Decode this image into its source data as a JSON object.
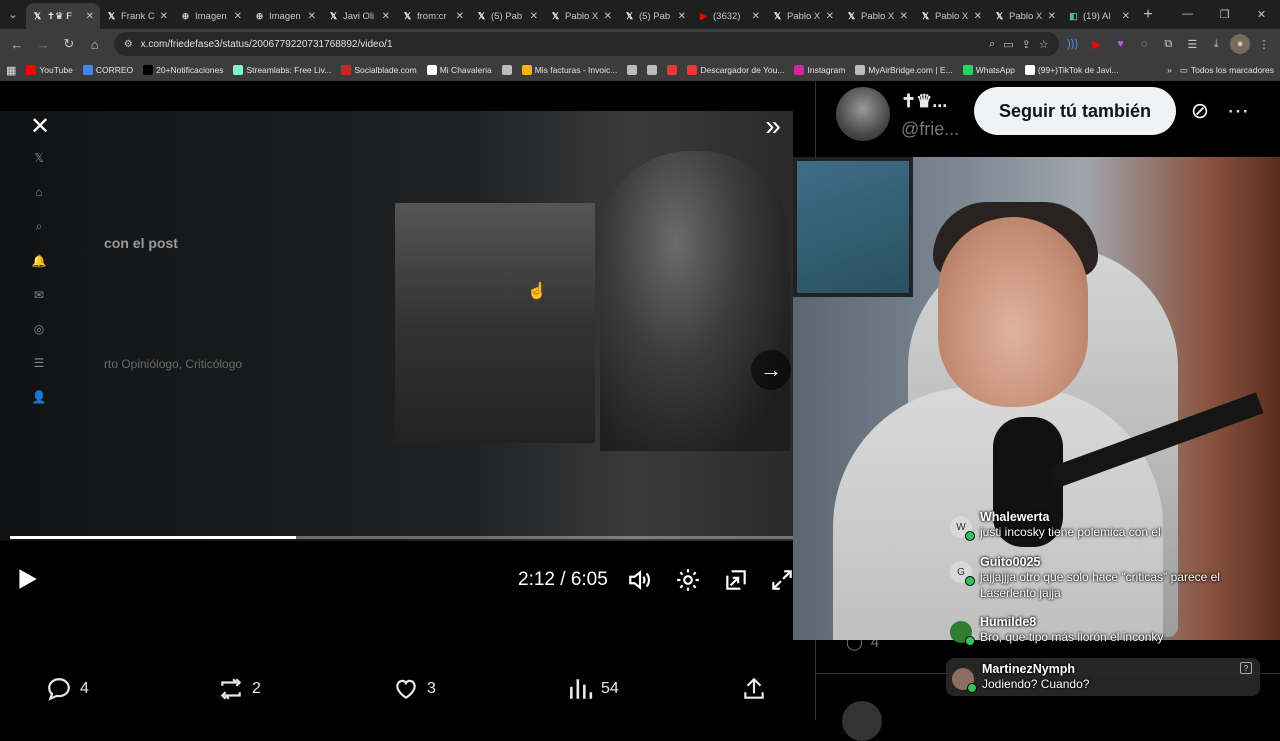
{
  "browser": {
    "tabs": [
      {
        "icon": "x-icon",
        "title": "✝♛ F",
        "active": true
      },
      {
        "icon": "x-icon",
        "title": "Frank C"
      },
      {
        "icon": "globe-icon",
        "title": "Imagen"
      },
      {
        "icon": "globe-icon",
        "title": "Imagen"
      },
      {
        "icon": "x-icon",
        "title": "Javi Oli"
      },
      {
        "icon": "x-icon",
        "title": "from:cr"
      },
      {
        "icon": "x-icon",
        "title": "(5) Pab"
      },
      {
        "icon": "x-icon",
        "title": "Pablo X"
      },
      {
        "icon": "x-icon",
        "title": "(5) Pab"
      },
      {
        "icon": "youtube-icon",
        "title": "(3632)"
      },
      {
        "icon": "x-icon",
        "title": "Pablo X"
      },
      {
        "icon": "x-icon",
        "title": "Pablo X"
      },
      {
        "icon": "x-icon",
        "title": "Pablo X"
      },
      {
        "icon": "x-icon",
        "title": "Pablo X"
      },
      {
        "icon": "site-icon",
        "title": "(19) Al"
      }
    ],
    "url": "x.com/friedefase3/status/2006779220731768892/video/1",
    "bookmarks": [
      {
        "icon": "youtube-icon",
        "label": "YouTube",
        "color": "#ff0000"
      },
      {
        "icon": "correo-icon",
        "label": "CORREO",
        "color": "#4285f4"
      },
      {
        "icon": "x-icon",
        "label": "20+Notificaciones",
        "color": "#000000"
      },
      {
        "icon": "streamlabs-icon",
        "label": "Streamlabs: Free Liv...",
        "color": "#80f5d2"
      },
      {
        "icon": "socialblade-icon",
        "label": "Socialblade.com",
        "color": "#c62828"
      },
      {
        "icon": "chavaleria-icon",
        "label": "Mi Chavaleria",
        "color": "#ffffff"
      },
      {
        "icon": "globe-icon",
        "label": "",
        "color": "#bbbbbb"
      },
      {
        "icon": "facturas-icon",
        "label": "Mis facturas - Invoic...",
        "color": "#f4b400"
      },
      {
        "icon": "globe-icon",
        "label": "",
        "color": "#bbbbbb"
      },
      {
        "icon": "globe-icon",
        "label": "",
        "color": "#bbbbbb"
      },
      {
        "icon": "apple-icon",
        "label": "",
        "color": "#e53935"
      },
      {
        "icon": "descargador-icon",
        "label": "Descargador de You...",
        "color": "#e53935"
      },
      {
        "icon": "instagram-icon",
        "label": "Instagram",
        "color": "#d6249f"
      },
      {
        "icon": "cloud-icon",
        "label": "MyAirBridge.com | E...",
        "color": "#bbbbbb"
      },
      {
        "icon": "whatsapp-icon",
        "label": "WhatsApp",
        "color": "#25d366"
      },
      {
        "icon": "tiktok-icon",
        "label": "(99+)TikTok de Javi...",
        "color": "#ffffff"
      }
    ],
    "bookmarks_folder": "Todos los marcadores"
  },
  "video": {
    "blurred_post_text": "con el post",
    "blurred_post_text2": "rto Opiniólogo, Criticólogo",
    "time": "2:12 / 6:05",
    "progress": 0.365
  },
  "actions": {
    "replies": "4",
    "reposts": "2",
    "likes": "3",
    "views": "54"
  },
  "side": {
    "name": "✝♛...",
    "handle": "@frie...",
    "follow_label": "Seguir tú también",
    "reply_count": "4"
  },
  "chat": [
    {
      "user": "Whalewerta",
      "message": "justi incosky tiene polemica con el",
      "avatar_letter": "W",
      "avatar_color": "#d9d9d9"
    },
    {
      "user": "Guito0025",
      "message": "jajjajjja otro que solo hace \"criticas\" parece el Laserlento jajja",
      "avatar_letter": "G",
      "avatar_color": "#d9d9d9"
    },
    {
      "user": "Humilde8",
      "message": "Bro, que tipo más llorón el inconky",
      "avatar_letter": "",
      "avatar_color": "#2e7d32"
    },
    {
      "user": "MartinezNymph",
      "message": "Jodiendo? Cuando?",
      "avatar_letter": "",
      "avatar_color": "#8d6e63"
    }
  ]
}
